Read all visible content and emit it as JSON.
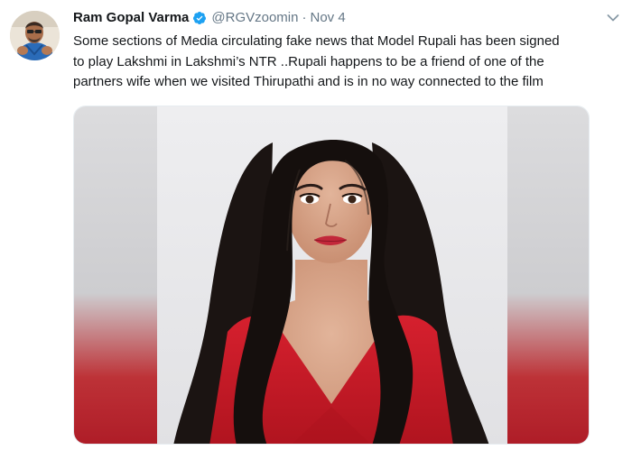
{
  "tweet": {
    "author_name": "Ram Gopal Varma",
    "handle": "@RGVzoomin",
    "separator": "·",
    "date": "Nov 4",
    "text_lines": [
      "Some sections of Media circulating fake news that Model Rupali has been signed",
      "to play Lakshmi in Lakshmi’s NTR ..Rupali happens to be a friend of one of the",
      "partners wife when we visited Thirupathi and is in no way connected to the film"
    ],
    "verified": true
  },
  "icons": {
    "verified": "verified-badge-icon",
    "menu": "chevron-down-icon"
  },
  "colors": {
    "verified_blue": "#1da1f2",
    "secondary_text": "#657786",
    "primary_text": "#14171a"
  }
}
